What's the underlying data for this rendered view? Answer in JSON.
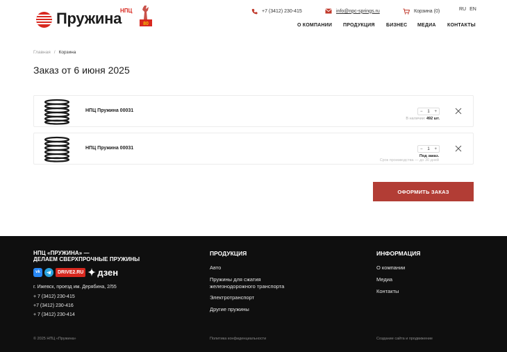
{
  "header": {
    "logo": {
      "word": "Пружина",
      "npc": "НПЦ",
      "badge": "80 лет"
    },
    "phone": "+7 (3412) 230-415",
    "email": "info@npc-springs.ru",
    "cart": "Корзина (0)",
    "langs": [
      "RU",
      "EN"
    ],
    "nav": [
      "О КОМПАНИИ",
      "ПРОДУКЦИЯ",
      "БИЗНЕС",
      "МЕДИА",
      "КОНТАКТЫ"
    ]
  },
  "breadcrumb": {
    "home": "Главная",
    "sep": "/",
    "current": "Корзина"
  },
  "page_title": "Заказ от 6 июня 2025",
  "items": [
    {
      "name": "НПЦ Пружина 00031",
      "qty": "1",
      "minus": "−",
      "plus": "+",
      "stock_label": "В наличии:",
      "stock_value": "492 шт."
    },
    {
      "name": "НПЦ Пружина 00031",
      "qty": "1",
      "minus": "−",
      "plus": "+",
      "order_type": "Под заказ.",
      "lead_time": "Срок производства — до 30 дней"
    }
  ],
  "checkout_label": "ОФОРМИТЬ ЗАКАЗ",
  "footer": {
    "brand_line1": "НПЦ «ПРУЖИНА» —",
    "brand_line2": "ДЕЛАЕМ СВЕРХПРОЧНЫЕ ПРУЖИНЫ",
    "social": {
      "vk": "vk",
      "drive": "DRIVE2.RU",
      "dzen": "дзен"
    },
    "address": "г. Ижевск, проезд им. Дерябина, 2/55",
    "phones": [
      "+ 7 (3412) 230-415",
      "+7 (3412) 230-416",
      "+ 7 (3412) 230-414"
    ],
    "products_title": "ПРОДУКЦИЯ",
    "products": [
      "Авто",
      "Пружины для сжатия железнодорожного транспорта",
      "Электротранспорт",
      "Другие пружины"
    ],
    "info_title": "ИНФОРМАЦИЯ",
    "info": [
      "О компании",
      "Медиа",
      "Контакты"
    ],
    "copyright": "© 2025 НПЦ «Пружина»",
    "privacy": "Политика конфиденциальности",
    "made_by": "Создание сайта и продвижение"
  },
  "colors": {
    "brand_red": "#d8281f",
    "button": "#b23d35",
    "footer_bg": "#0f0f0f"
  }
}
